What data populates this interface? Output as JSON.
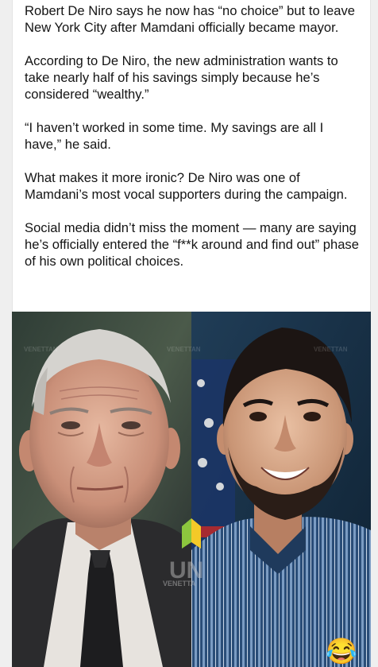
{
  "post": {
    "paragraphs": [
      "Robert De Niro says he now has “no choice” but to leave New York City after Mamdani officially became mayor.",
      "According to De Niro, the new administration wants to take nearly half of his savings simply because he’s considered “wealthy.”",
      "“I haven’t worked in some time. My savings are all I have,” he said.",
      "What makes it more ironic? De Niro was one of Mamdani’s most vocal supporters during the campaign.",
      "Social media didn’t miss the moment — many are saying he’s officially entered the “f**k around and find out” phase of his own political choices."
    ]
  },
  "media": {
    "watermark": "UN",
    "watermark_sub": "VENETTA",
    "faint_watermark": "VENETTAN"
  },
  "reaction": {
    "emoji": "😂",
    "icon": "laughing-crying-emoji-icon"
  },
  "colors": {
    "text": "#141414",
    "card_bg": "#ffffff",
    "page_bg": "#efefef"
  }
}
